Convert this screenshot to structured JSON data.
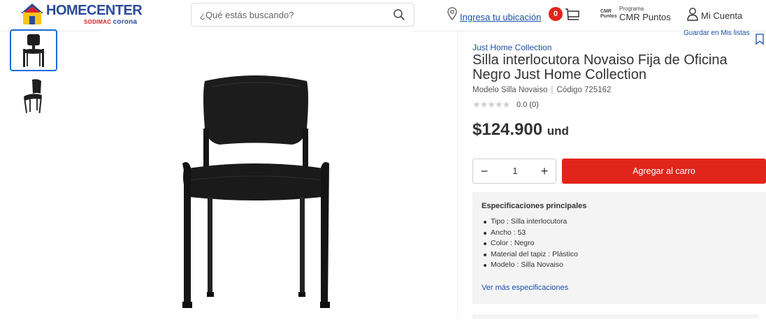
{
  "header": {
    "logo": {
      "text": "HOMECENTER",
      "sub_brand": "SODIMAC",
      "sub_brand2": "corona"
    },
    "search": {
      "placeholder": "¿Qué estás buscando?",
      "icon": "search-icon"
    },
    "location_link": "Ingresa tu ubicación",
    "cart_count": "0",
    "cmr": {
      "logo_text": "CMR Puntos",
      "program_label": "Programa",
      "name": "CMR Puntos"
    },
    "account_label": "Mi Cuenta"
  },
  "gallery": {
    "thumbnail_count": 2,
    "active_index": 0
  },
  "product": {
    "save_list_label": "Guardar en Mis listas",
    "brand": "Just Home Collection",
    "title": "Silla interlocutora Novaiso Fija de Oficina Negro Just Home Collection",
    "model": "Modelo Silla Novaiso",
    "code": "Código 725162",
    "rating": "0.0 (0)",
    "price": "$124.900",
    "price_unit": "und",
    "quantity": "1",
    "minus_label": "−",
    "plus_label": "+",
    "add_to_cart_label": "Agregar al carro"
  },
  "specs": {
    "title": "Especificaciones principales",
    "items": [
      "Tipo : Silla interlocutora",
      "Ancho : 53",
      "Color : Negro",
      "Material del tapiz : Plástico",
      "Modelo : Silla Novaiso"
    ],
    "more_link": "Ver más especificaciones"
  },
  "colors": {
    "brand_blue": "#2b4a9a",
    "accent_red": "#e1251b",
    "link_blue": "#1a4ea8"
  }
}
